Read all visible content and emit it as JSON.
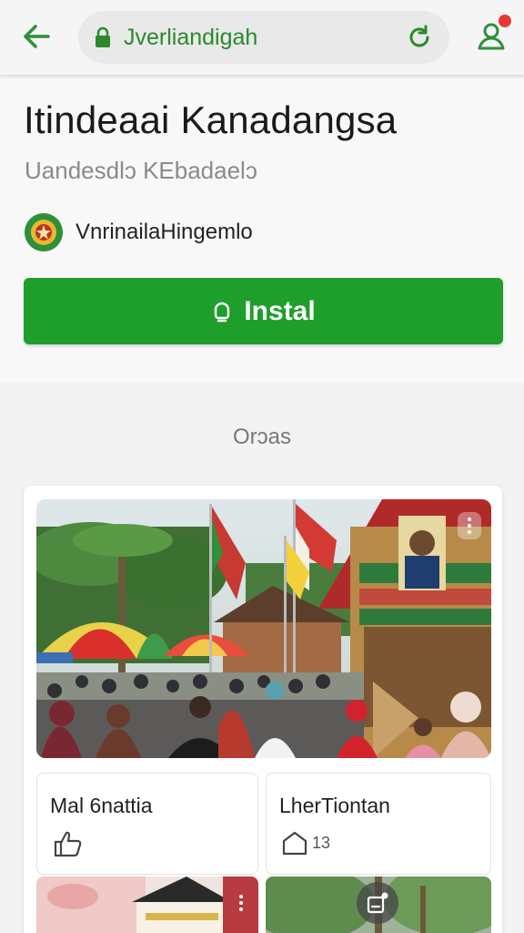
{
  "browser": {
    "url": "Jverliandigah",
    "accent_color": "#2a8a2a",
    "icons": {
      "back": "arrow-left-icon",
      "lock": "lock-icon",
      "reload": "reload-icon",
      "profile": "profile-icon"
    }
  },
  "app": {
    "title": "Itindeaai Kanadangsa",
    "subtitle": "Uandesdlɔ KEbadaelɔ",
    "developer": "VnrinailaHingemlo",
    "install_label": "Instal",
    "install_color": "#1e9e2b"
  },
  "section": {
    "label": "Orɔas"
  },
  "tiles": [
    {
      "title": "Mal 6nattia",
      "meta_icon": "thumbs-up-icon",
      "meta_value": ""
    },
    {
      "title": "LherTiontan",
      "meta_icon": "house-icon",
      "meta_value": "13"
    }
  ]
}
